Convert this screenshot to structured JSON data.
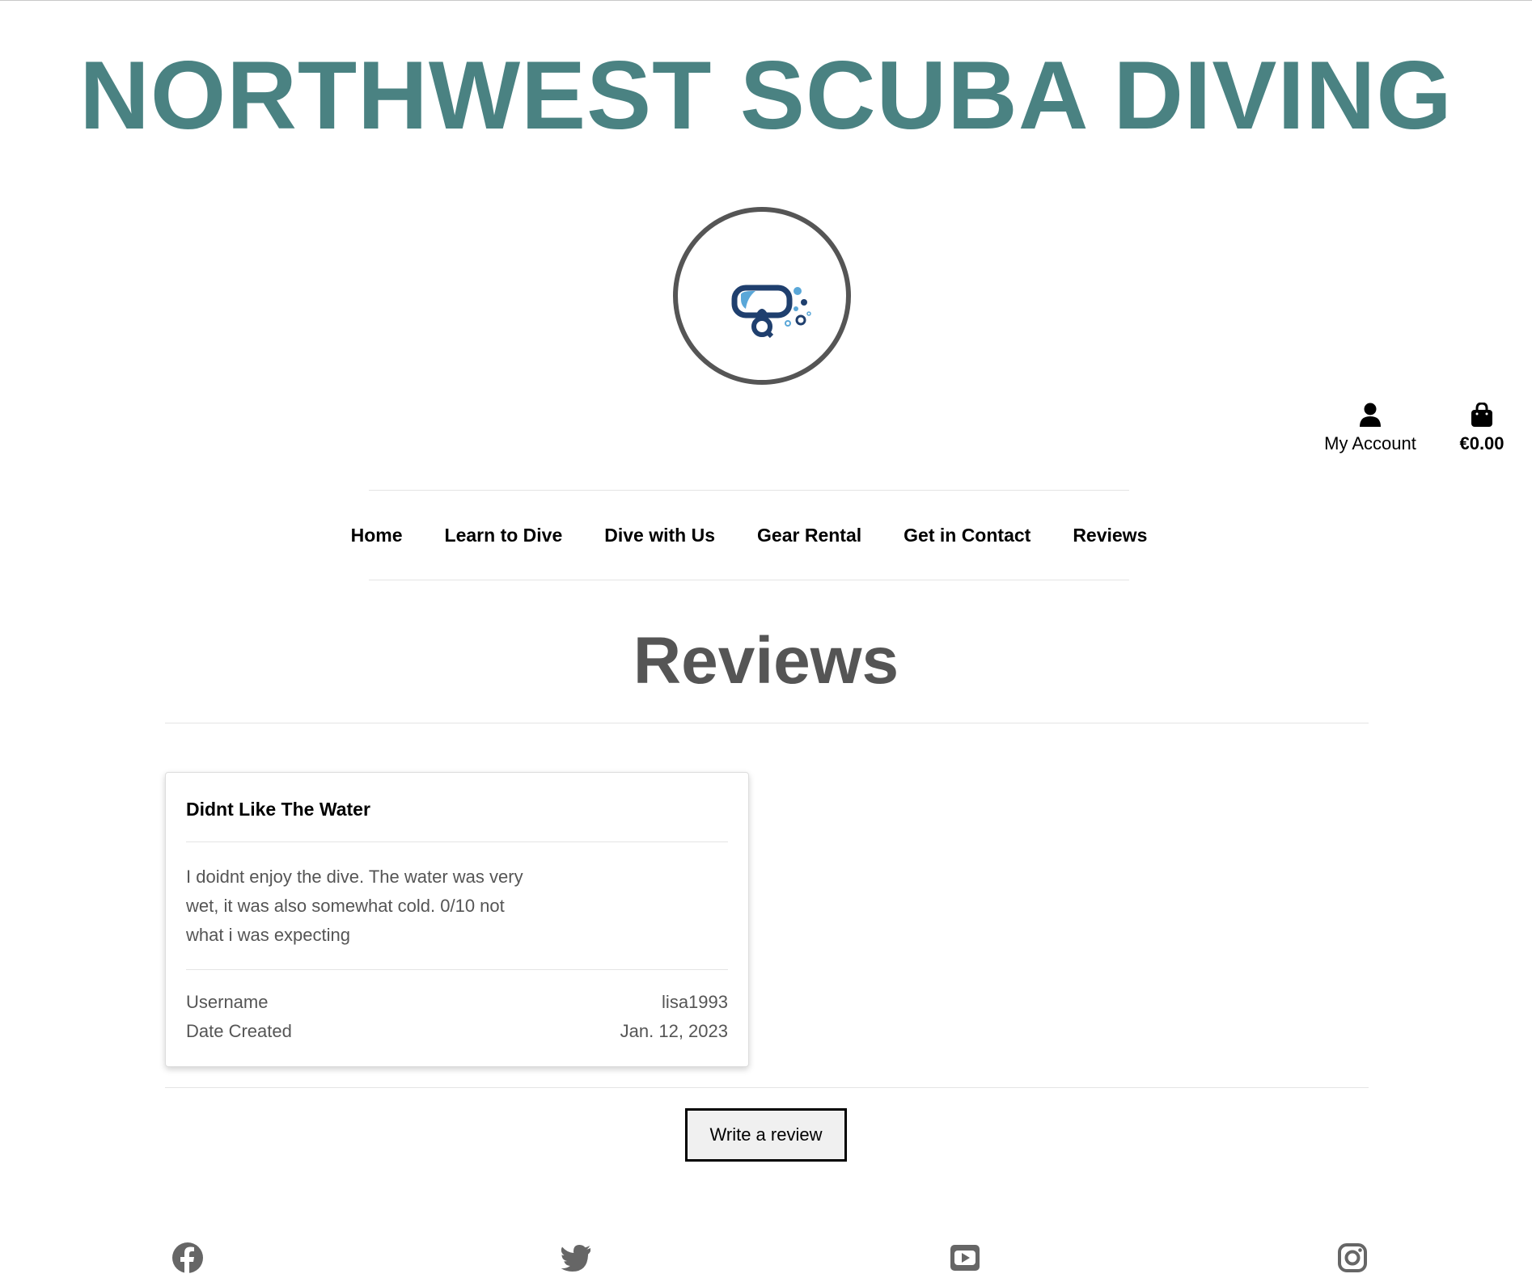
{
  "header": {
    "site_title": "NORTHWEST SCUBA DIVING",
    "logo_icon": "scuba-mask-icon",
    "account_label": "My Account",
    "cart_total": "€0.00"
  },
  "nav": {
    "items": [
      {
        "label": "Home"
      },
      {
        "label": "Learn to Dive"
      },
      {
        "label": "Dive with Us"
      },
      {
        "label": "Gear Rental"
      },
      {
        "label": "Get in Contact"
      },
      {
        "label": "Reviews"
      }
    ]
  },
  "main": {
    "heading": "Reviews",
    "reviews": [
      {
        "title": "Didnt Like The Water",
        "body": "I doidnt enjoy the dive. The water was very wet, it was also somewhat cold. 0/10 not what i was expecting",
        "username_label": "Username",
        "username": "lisa1993",
        "date_label": "Date Created",
        "date": "Jan. 12, 2023"
      }
    ],
    "write_review_label": "Write a review"
  },
  "footer": {
    "social_icons": [
      "facebook-icon",
      "twitter-icon",
      "youtube-icon",
      "instagram-icon"
    ]
  },
  "colors": {
    "brand": "#4a8282",
    "text": "#555555",
    "logo_dark": "#1f3f6e",
    "logo_light": "#5aa7d8"
  }
}
